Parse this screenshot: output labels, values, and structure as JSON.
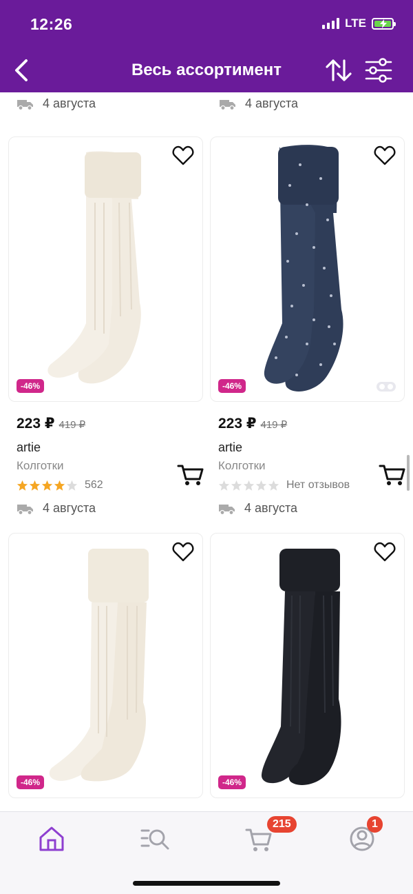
{
  "status_bar": {
    "time": "12:26",
    "network": "LTE"
  },
  "header": {
    "title": "Весь ассортимент"
  },
  "top_row": {
    "delivery_left": "4 августа",
    "delivery_right": "4 августа"
  },
  "products": [
    {
      "discount": "-46%",
      "price": "223 ₽",
      "old_price": "419 ₽",
      "brand": "artie",
      "category": "Колготки",
      "rating": 4,
      "rating_text": "562",
      "delivery": "4 августа",
      "color": "cream"
    },
    {
      "discount": "-46%",
      "price": "223 ₽",
      "old_price": "419 ₽",
      "brand": "artie",
      "category": "Колготки",
      "rating": 0,
      "rating_text": "Нет отзывов",
      "delivery": "4 августа",
      "color": "navy"
    },
    {
      "discount": "-46%",
      "color": "cream"
    },
    {
      "discount": "-46%",
      "color": "black"
    }
  ],
  "bottom_nav": {
    "items": [
      "home",
      "catalog-search",
      "cart",
      "profile"
    ],
    "cart_badge": "215",
    "profile_badge": "1"
  },
  "colors": {
    "accent": "#6a1b9a",
    "discount_badge": "#d0278a",
    "star": "#f5a623",
    "notification": "#e74431",
    "nav_active": "#8e3fd0"
  }
}
